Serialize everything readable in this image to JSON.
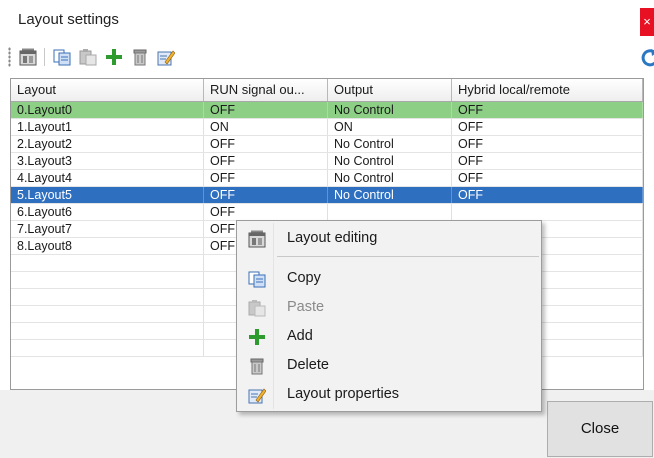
{
  "window": {
    "title": "Layout settings",
    "close_glyph": "×"
  },
  "toolbar": {
    "buttons": [
      {
        "icon": "layout-editing-icon"
      },
      {
        "icon": "copy-icon"
      },
      {
        "icon": "paste-icon"
      },
      {
        "icon": "add-icon"
      },
      {
        "icon": "delete-icon"
      },
      {
        "icon": "properties-icon"
      }
    ],
    "refresh_icon": "refresh-icon"
  },
  "grid": {
    "columns": [
      "Layout",
      "RUN signal ou...",
      "Output",
      "Hybrid local/remote"
    ],
    "rows": [
      {
        "layout": "0.Layout0",
        "run": "OFF",
        "output": "No Control",
        "hybrid": "OFF",
        "state": "green"
      },
      {
        "layout": "1.Layout1",
        "run": "ON",
        "output": "ON",
        "hybrid": "OFF",
        "state": ""
      },
      {
        "layout": "2.Layout2",
        "run": "OFF",
        "output": "No Control",
        "hybrid": "OFF",
        "state": ""
      },
      {
        "layout": "3.Layout3",
        "run": "OFF",
        "output": "No Control",
        "hybrid": "OFF",
        "state": ""
      },
      {
        "layout": "4.Layout4",
        "run": "OFF",
        "output": "No Control",
        "hybrid": "OFF",
        "state": ""
      },
      {
        "layout": "5.Layout5",
        "run": "OFF",
        "output": "No Control",
        "hybrid": "OFF",
        "state": "blue"
      },
      {
        "layout": "6.Layout6",
        "run": "OFF",
        "output": "",
        "hybrid": "",
        "state": ""
      },
      {
        "layout": "7.Layout7",
        "run": "OFF",
        "output": "",
        "hybrid": "",
        "state": ""
      },
      {
        "layout": "8.Layout8",
        "run": "OFF",
        "output": "",
        "hybrid": "",
        "state": ""
      },
      {
        "layout": "",
        "run": "",
        "output": "",
        "hybrid": "",
        "state": ""
      },
      {
        "layout": "",
        "run": "",
        "output": "",
        "hybrid": "",
        "state": ""
      },
      {
        "layout": "",
        "run": "",
        "output": "",
        "hybrid": "",
        "state": ""
      },
      {
        "layout": "",
        "run": "",
        "output": "",
        "hybrid": "",
        "state": ""
      },
      {
        "layout": "",
        "run": "",
        "output": "",
        "hybrid": "",
        "state": ""
      },
      {
        "layout": "",
        "run": "",
        "output": "",
        "hybrid": "",
        "state": ""
      }
    ],
    "colors": {
      "green_row": "#8ccf85",
      "blue_row": "#2f6fc0"
    }
  },
  "context_menu": {
    "items": [
      {
        "label": "Layout editing",
        "icon": "layout-editing-icon",
        "enabled": true
      },
      {
        "label": "Copy",
        "icon": "copy-icon",
        "enabled": true
      },
      {
        "label": "Paste",
        "icon": "paste-icon",
        "enabled": false
      },
      {
        "label": "Add",
        "icon": "add-icon",
        "enabled": true
      },
      {
        "label": "Delete",
        "icon": "delete-icon",
        "enabled": true
      },
      {
        "label": "Layout properties",
        "icon": "properties-icon",
        "enabled": true
      }
    ]
  },
  "footer": {
    "close_label": "Close"
  }
}
